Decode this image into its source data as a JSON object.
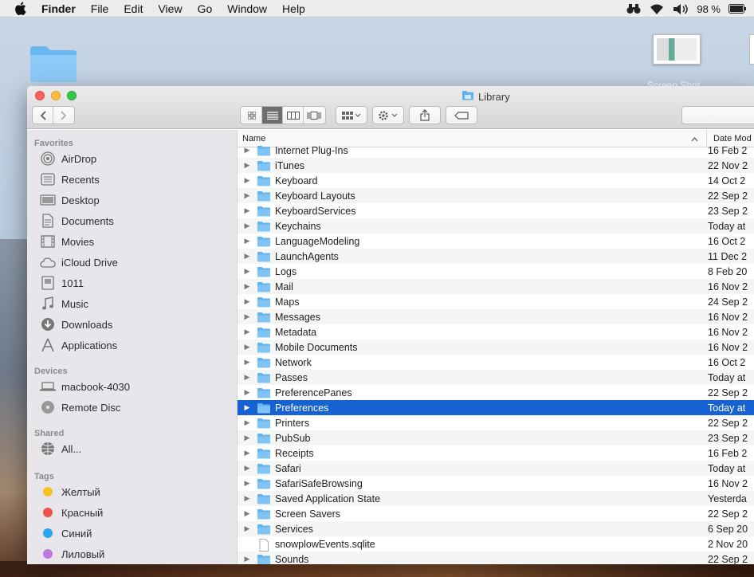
{
  "menubar": {
    "app": "Finder",
    "items": [
      "File",
      "Edit",
      "View",
      "Go",
      "Window",
      "Help"
    ],
    "battery": "98 %"
  },
  "desktop": {
    "screenshot_label": "Screen Shot"
  },
  "window": {
    "title": "Library"
  },
  "sidebar": {
    "favorites_header": "Favorites",
    "favorites": [
      {
        "label": "AirDrop",
        "icon": "airdrop-icon"
      },
      {
        "label": "Recents",
        "icon": "recents-icon"
      },
      {
        "label": "Desktop",
        "icon": "desktop-icon"
      },
      {
        "label": "Documents",
        "icon": "documents-icon"
      },
      {
        "label": "Movies",
        "icon": "movies-icon"
      },
      {
        "label": "iCloud Drive",
        "icon": "cloud-icon"
      },
      {
        "label": "1011",
        "icon": "home-icon"
      },
      {
        "label": "Music",
        "icon": "music-icon"
      },
      {
        "label": "Downloads",
        "icon": "downloads-icon"
      },
      {
        "label": "Applications",
        "icon": "applications-icon"
      }
    ],
    "devices_header": "Devices",
    "devices": [
      {
        "label": "macbook-4030",
        "icon": "laptop-icon"
      },
      {
        "label": "Remote Disc",
        "icon": "disc-icon"
      }
    ],
    "shared_header": "Shared",
    "shared": [
      {
        "label": "All...",
        "icon": "network-icon"
      }
    ],
    "tags_header": "Tags",
    "tags": [
      {
        "label": "Желтый",
        "color": "#f5c42c"
      },
      {
        "label": "Красный",
        "color": "#f0504a"
      },
      {
        "label": "Синий",
        "color": "#2aa3f0"
      },
      {
        "label": "Лиловый",
        "color": "#c177e0"
      }
    ]
  },
  "list": {
    "col_name": "Name",
    "col_date": "Date Mod",
    "rows": [
      {
        "name": "Internet Plug-Ins",
        "date": "16 Feb 2",
        "type": "folder"
      },
      {
        "name": "iTunes",
        "date": "22 Nov 2",
        "type": "folder"
      },
      {
        "name": "Keyboard",
        "date": "14 Oct 2",
        "type": "folder"
      },
      {
        "name": "Keyboard Layouts",
        "date": "22 Sep 2",
        "type": "folder"
      },
      {
        "name": "KeyboardServices",
        "date": "23 Sep 2",
        "type": "folder"
      },
      {
        "name": "Keychains",
        "date": "Today at",
        "type": "folder"
      },
      {
        "name": "LanguageModeling",
        "date": "16 Oct 2",
        "type": "folder"
      },
      {
        "name": "LaunchAgents",
        "date": "11 Dec 2",
        "type": "folder"
      },
      {
        "name": "Logs",
        "date": "8 Feb 20",
        "type": "folder"
      },
      {
        "name": "Mail",
        "date": "16 Nov 2",
        "type": "folder"
      },
      {
        "name": "Maps",
        "date": "24 Sep 2",
        "type": "folder"
      },
      {
        "name": "Messages",
        "date": "16 Nov 2",
        "type": "folder"
      },
      {
        "name": "Metadata",
        "date": "16 Nov 2",
        "type": "folder"
      },
      {
        "name": "Mobile Documents",
        "date": "16 Nov 2",
        "type": "folder"
      },
      {
        "name": "Network",
        "date": "16 Oct 2",
        "type": "folder"
      },
      {
        "name": "Passes",
        "date": "Today at",
        "type": "folder"
      },
      {
        "name": "PreferencePanes",
        "date": "22 Sep 2",
        "type": "folder"
      },
      {
        "name": "Preferences",
        "date": "Today at",
        "type": "folder",
        "selected": true
      },
      {
        "name": "Printers",
        "date": "22 Sep 2",
        "type": "folder"
      },
      {
        "name": "PubSub",
        "date": "23 Sep 2",
        "type": "folder"
      },
      {
        "name": "Receipts",
        "date": "16 Feb 2",
        "type": "folder"
      },
      {
        "name": "Safari",
        "date": "Today at",
        "type": "folder"
      },
      {
        "name": "SafariSafeBrowsing",
        "date": "16 Nov 2",
        "type": "folder"
      },
      {
        "name": "Saved Application State",
        "date": "Yesterda",
        "type": "folder"
      },
      {
        "name": "Screen Savers",
        "date": "22 Sep 2",
        "type": "folder"
      },
      {
        "name": "Services",
        "date": "6 Sep 20",
        "type": "folder"
      },
      {
        "name": "snowplowEvents.sqlite",
        "date": "2 Nov 20",
        "type": "file"
      },
      {
        "name": "Sounds",
        "date": "22 Sep 2",
        "type": "folder"
      }
    ]
  }
}
